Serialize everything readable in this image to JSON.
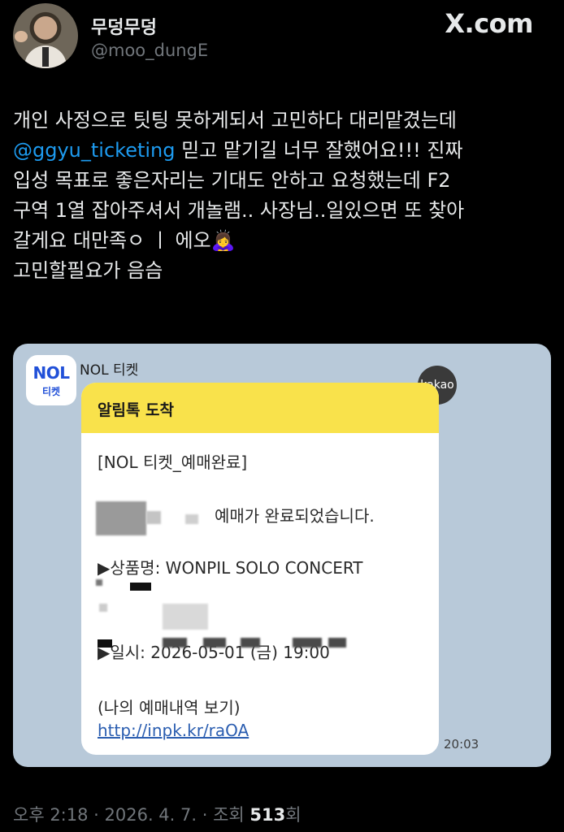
{
  "author": {
    "display_name": "무덩무덩",
    "handle": "@moo_dungE"
  },
  "brand": "X.com",
  "tweet": {
    "line1": "개인 사정으로 팃팅 못하게되서 고민하다 대리맡겼는데",
    "mention": "@ggyu_ticketing",
    "line2_rest": " 믿고 맡기길 너무 잘했어요!!! 진짜",
    "line3": "입성 목표로 좋은자리는 기대도 안하고 요청했는데 F2",
    "line4": "구역 1열 잡아주셔서 개놀램.. 사장님..일있으면 또 찾아",
    "line5": "갈게요 대만족ㅇ ㅣ 에오🙇‍♀️",
    "line6": "고민할필요가 음슴"
  },
  "media": {
    "sender_logo_top": "NOL",
    "sender_logo_bottom": "티켓",
    "sender_name": "NOL 티켓",
    "kakao_badge": "kakao",
    "bubble_title": "알림톡 도착",
    "lines": {
      "header": "[NOL 티켓_예매완료]",
      "complete": "예매가 완료되었습니다.",
      "product": "▶상품명: WONPIL SOLO CONCERT",
      "date": "▶일시: 2026-05-01 (금) 19:00",
      "history": "(나의 예매내역 보기)",
      "link": "http://inpk.kr/raOA"
    },
    "time": "20:03"
  },
  "meta": {
    "time": "오후 2:18",
    "sep": " · ",
    "date": "2026. 4. 7.",
    "views_label": "조회",
    "views_count": "513",
    "views_unit": "회"
  }
}
